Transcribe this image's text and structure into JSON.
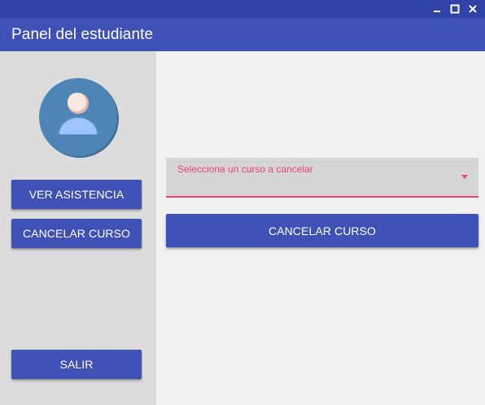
{
  "window": {
    "title_bar_color": "#3142a6",
    "controls": [
      {
        "name": "minimize",
        "icon": "minimize-icon"
      },
      {
        "name": "maximize",
        "icon": "maximize-icon"
      },
      {
        "name": "close",
        "icon": "close-icon"
      }
    ]
  },
  "appbar": {
    "title": "Panel del estudiante",
    "color": "#3f51b5"
  },
  "sidebar": {
    "avatar_icon": "user-avatar-icon",
    "buttons": {
      "ver_asistencia": "VER ASISTENCIA",
      "cancelar_curso": "CANCELAR CURSO",
      "salir": "SALIR"
    }
  },
  "main": {
    "course_select": {
      "label": "Selecciona un curso a cancelar",
      "value": "",
      "accent_color": "#ec407a"
    },
    "cancel_button": "CANCELAR CURSO"
  }
}
